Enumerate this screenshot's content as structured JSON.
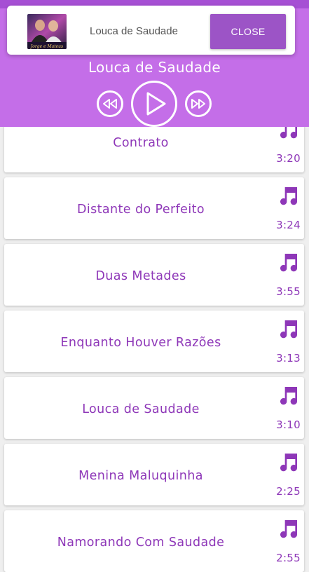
{
  "notification": {
    "title": "Louca de Saudade",
    "close_label": "CLOSE",
    "thumb_caption": "Jorge e Mateus"
  },
  "player": {
    "now_playing": "Louca de Saudade"
  },
  "songs": [
    {
      "title": "Contrato",
      "duration": "3:20"
    },
    {
      "title": "Distante do Perfeito",
      "duration": "3:24"
    },
    {
      "title": "Duas Metades",
      "duration": "3:55"
    },
    {
      "title": "Enquanto Houver Razões",
      "duration": "3:13"
    },
    {
      "title": "Louca de Saudade",
      "duration": "3:10"
    },
    {
      "title": "Menina Maluquinha",
      "duration": "2:25"
    },
    {
      "title": "Namorando Com Saudade",
      "duration": "2:55"
    }
  ],
  "colors": {
    "header": "#c46ee8",
    "accent": "#8e37b8",
    "close_button": "#9c54c6"
  },
  "icons": {
    "song": "music-note-icon",
    "prev": "rewind-icon",
    "play": "play-icon",
    "next": "fast-forward-icon"
  }
}
